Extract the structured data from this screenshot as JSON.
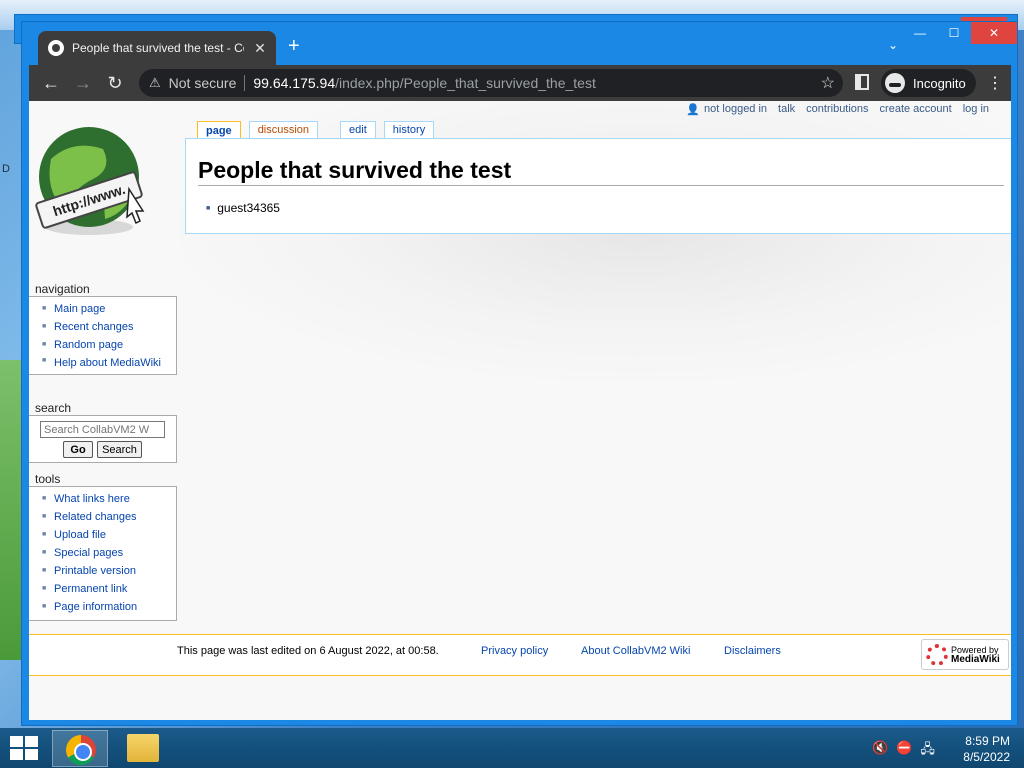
{
  "desktop": {
    "edge_label": "D"
  },
  "background_window": {
    "minimize": "—",
    "maximize": "☐",
    "close": "✕"
  },
  "browser": {
    "tab": {
      "title": "People that survived the test - Co",
      "close": "✕"
    },
    "new_tab": "+",
    "tab_search": "⌄",
    "window_controls": {
      "minimize": "—",
      "maximize": "☐",
      "close": "✕"
    },
    "toolbar": {
      "back": "←",
      "forward": "→",
      "reload": "↻",
      "security_icon": "⚠",
      "security_label": "Not secure",
      "url_host": "99.64.175.94",
      "url_path": "/index.php/People_that_survived_the_test",
      "bookmark_star": "☆",
      "incognito_label": "Incognito",
      "menu": "⋮"
    }
  },
  "wiki": {
    "personal_tools": {
      "not_logged_in": "not logged in",
      "talk": "talk",
      "contributions": "contributions",
      "create_account": "create account",
      "log_in": "log in"
    },
    "logo_text": "http://www.",
    "tabs": {
      "page": "page",
      "discussion": "discussion",
      "edit": "edit",
      "history": "history"
    },
    "heading": "People that survived the test",
    "list_items": [
      "guest34365"
    ],
    "navigation": {
      "title": "navigation",
      "items": [
        "Main page",
        "Recent changes",
        "Random page",
        "Help about MediaWiki"
      ]
    },
    "search": {
      "title": "search",
      "placeholder": "Search CollabVM2 W",
      "go": "Go",
      "search": "Search"
    },
    "tools": {
      "title": "tools",
      "items": [
        "What links here",
        "Related changes",
        "Upload file",
        "Special pages",
        "Printable version",
        "Permanent link",
        "Page information"
      ]
    },
    "footer": {
      "last_edited": "This page was last edited on 6 August 2022, at 00:58.",
      "privacy": "Privacy policy",
      "about": "About CollabVM2 Wiki",
      "disclaimers": "Disclaimers",
      "powered_by_small": "Powered by",
      "powered_by_big": "MediaWiki"
    }
  },
  "taskbar": {
    "time": "8:59 PM",
    "date": "8/5/2022",
    "tray_icons": [
      "speaker-muted-icon",
      "network-error-icon",
      "network-icon"
    ]
  },
  "colors": {
    "titlebar": "#1a88e4",
    "link": "#0645ad",
    "accent": "#fabd23"
  }
}
